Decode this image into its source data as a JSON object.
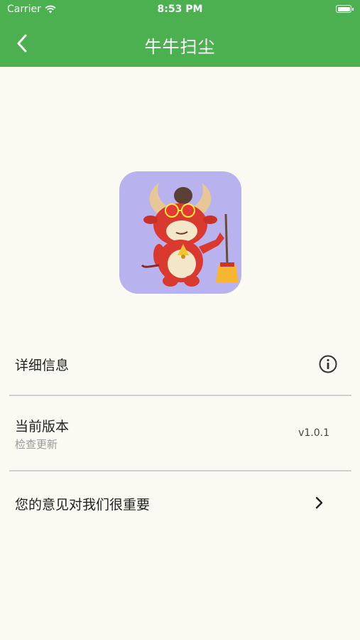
{
  "status_bar": {
    "carrier": "Carrier",
    "time": "8:53 PM"
  },
  "nav": {
    "title": "牛牛扫尘",
    "back_icon": "chevron-left-icon"
  },
  "app_icon": {
    "description_icon": "bull-mascot-with-broom",
    "background": "#b8b3ee"
  },
  "rows": {
    "details": {
      "label": "详细信息",
      "icon": "info-icon"
    },
    "version": {
      "label": "当前版本",
      "sublabel": "检查更新",
      "value": "v1.0.1"
    },
    "feedback": {
      "label": "您的意见对我们很重要",
      "icon": "chevron-right-icon"
    }
  },
  "colors": {
    "accent": "#4caf50",
    "background": "#fafaf3"
  }
}
